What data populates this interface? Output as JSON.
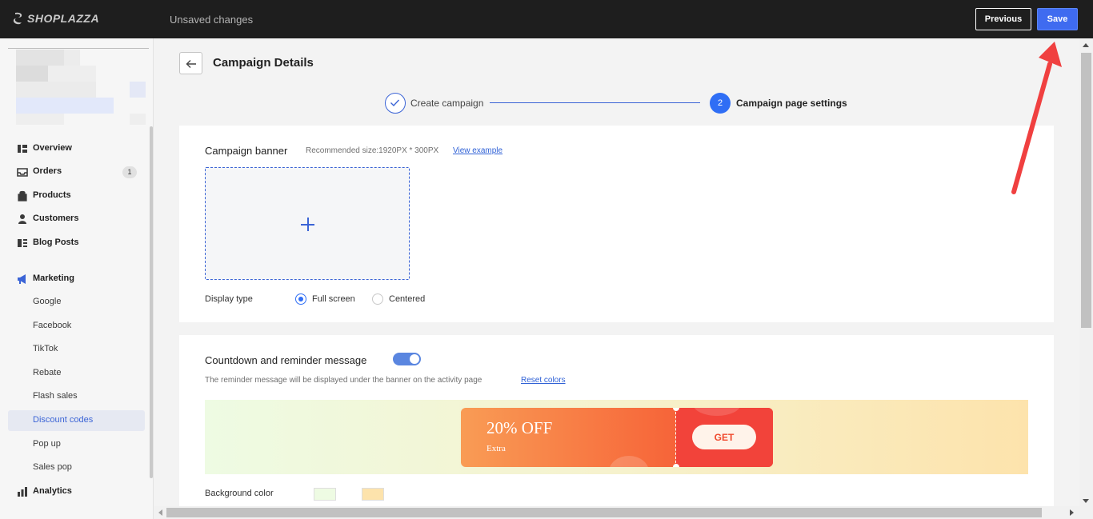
{
  "app": {
    "brand": "SHOPLAZZA",
    "status": "Unsaved changes"
  },
  "toolbar": {
    "previous_label": "Previous",
    "save_label": "Save"
  },
  "sidebar": {
    "items": [
      {
        "label": "Overview",
        "icon": "overview-icon"
      },
      {
        "label": "Orders",
        "icon": "orders-icon",
        "badge": "1"
      },
      {
        "label": "Products",
        "icon": "products-icon"
      },
      {
        "label": "Customers",
        "icon": "customers-icon"
      },
      {
        "label": "Blog Posts",
        "icon": "blog-icon"
      },
      {
        "label": "Marketing",
        "icon": "megaphone-icon"
      },
      {
        "label": "Google"
      },
      {
        "label": "Facebook"
      },
      {
        "label": "TikTok"
      },
      {
        "label": "Rebate"
      },
      {
        "label": "Flash sales"
      },
      {
        "label": "Discount codes",
        "active": true
      },
      {
        "label": "Pop up"
      },
      {
        "label": "Sales pop"
      },
      {
        "label": "Analytics",
        "icon": "analytics-icon"
      }
    ]
  },
  "page": {
    "title": "Campaign Details"
  },
  "steps": [
    {
      "label": "Create campaign",
      "state": "done"
    },
    {
      "number": "2",
      "label": "Campaign page settings",
      "state": "current"
    }
  ],
  "banner": {
    "title": "Campaign banner",
    "size_hint": "Recommended size:1920PX * 300PX",
    "view_example": "View example",
    "display_type_label": "Display type",
    "options": [
      {
        "label": "Full screen",
        "selected": true
      },
      {
        "label": "Centered",
        "selected": false
      }
    ]
  },
  "countdown": {
    "title": "Countdown and reminder message",
    "enabled": true,
    "description": "The reminder message will be displayed under the banner on the activity page",
    "reset_colors": "Reset colors",
    "coupon": {
      "headline": "20% OFF",
      "subline": "Extra",
      "button": "GET"
    },
    "background_color_label": "Background color",
    "background_colors": [
      "#eefbe3",
      "#fde3ac"
    ]
  },
  "colors": {
    "accent": "#2f6ef5",
    "topbar": "#1e1e1e",
    "annotation_arrow": "#f04040"
  }
}
